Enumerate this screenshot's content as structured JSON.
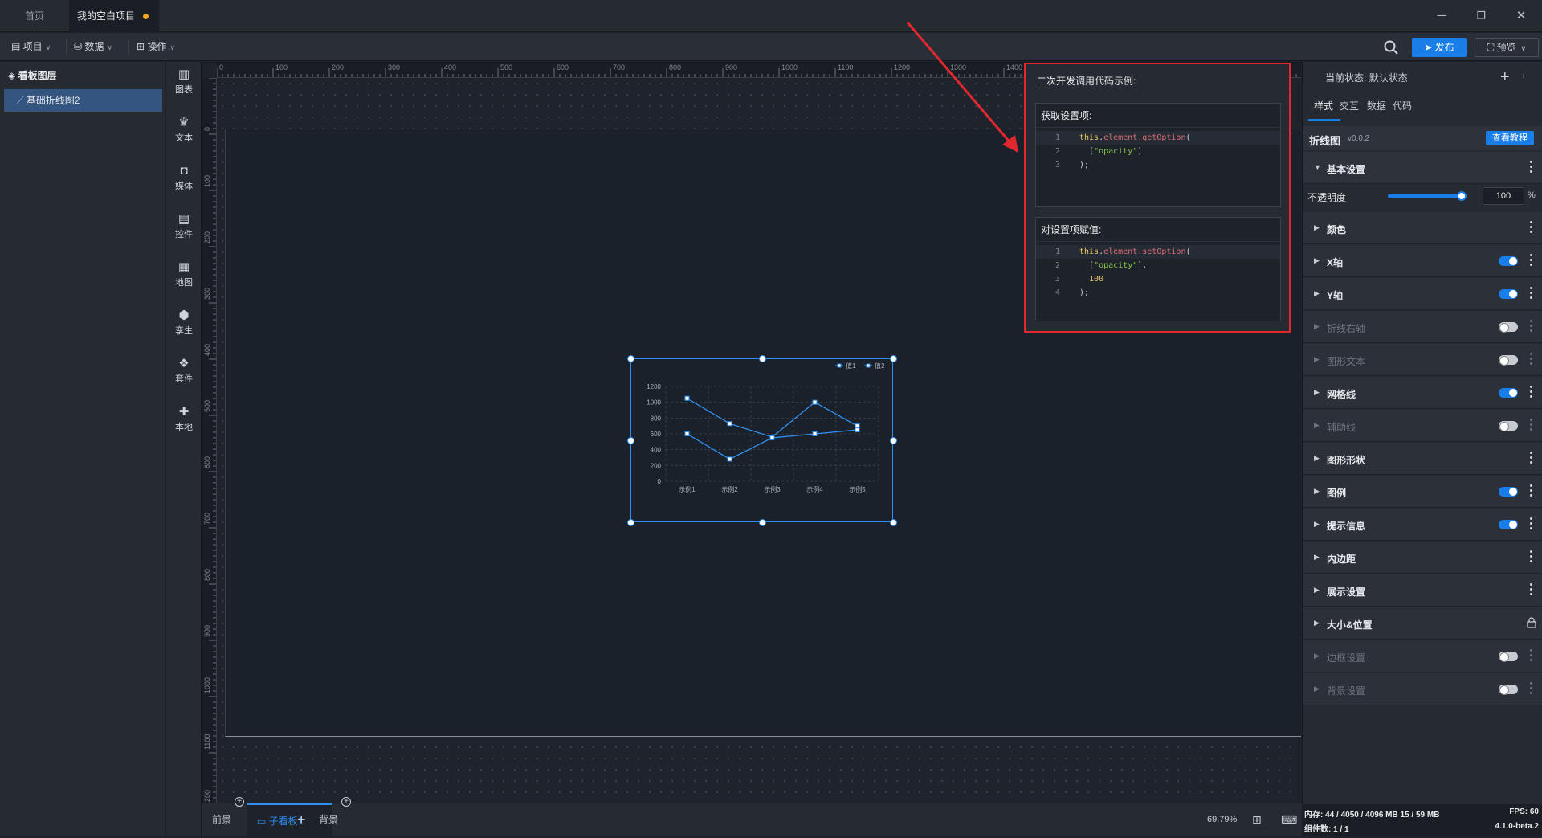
{
  "titlebar": {
    "tabs": [
      {
        "label": "首页"
      },
      {
        "label": "我的空白项目"
      }
    ]
  },
  "menubar": {
    "menus": [
      {
        "label": "项目"
      },
      {
        "label": "数据"
      },
      {
        "label": "操作"
      }
    ],
    "publish": "发布",
    "preview": "预览"
  },
  "layers": {
    "title": "看板图层",
    "items": [
      {
        "label": "基础折线图2"
      }
    ]
  },
  "toolbox": [
    {
      "label": "图表",
      "icon": "bar-chart-icon"
    },
    {
      "label": "文本",
      "icon": "text-icon"
    },
    {
      "label": "媒体",
      "icon": "media-icon"
    },
    {
      "label": "控件",
      "icon": "widget-icon"
    },
    {
      "label": "地图",
      "icon": "map-icon"
    },
    {
      "label": "孪生",
      "icon": "twin-cube-icon"
    },
    {
      "label": "套件",
      "icon": "suite-icon"
    },
    {
      "label": "本地",
      "icon": "puzzle-icon"
    }
  ],
  "ruler": {
    "top": [
      "0",
      "100",
      "200",
      "300",
      "400",
      "500",
      "600",
      "700",
      "800",
      "900",
      "1000",
      "1100",
      "1200",
      "1300",
      "1400"
    ],
    "left": [
      "0",
      "100",
      "200",
      "300",
      "400",
      "500",
      "600",
      "700",
      "800",
      "900",
      "1000",
      "1100",
      "1200"
    ]
  },
  "code_popup": {
    "title": "二次开发调用代码示例:",
    "get_title": "获取设置项:",
    "get_lines": [
      {
        "n": "1",
        "parts": [
          [
            "kw",
            "this"
          ],
          [
            "pl",
            "."
          ],
          [
            "fn",
            "element.getOption"
          ],
          [
            "pl",
            "("
          ]
        ]
      },
      {
        "n": "2",
        "parts": [
          [
            "pl",
            "  ["
          ],
          [
            "str",
            "\"opacity\""
          ],
          [
            "pl",
            "]"
          ]
        ]
      },
      {
        "n": "3",
        "parts": [
          [
            "pl",
            ");"
          ]
        ]
      }
    ],
    "set_title": "对设置项赋值:",
    "set_lines": [
      {
        "n": "1",
        "parts": [
          [
            "kw",
            "this"
          ],
          [
            "pl",
            "."
          ],
          [
            "fn",
            "element.setOption"
          ],
          [
            "pl",
            "("
          ]
        ]
      },
      {
        "n": "2",
        "parts": [
          [
            "pl",
            "  ["
          ],
          [
            "str",
            "\"opacity\""
          ],
          [
            "pl",
            "],"
          ]
        ]
      },
      {
        "n": "3",
        "parts": [
          [
            "num",
            "  100"
          ]
        ]
      },
      {
        "n": "4",
        "parts": [
          [
            "pl",
            ");"
          ]
        ]
      }
    ]
  },
  "chart_data": {
    "type": "line",
    "categories": [
      "示例1",
      "示例2",
      "示例3",
      "示例4",
      "示例5"
    ],
    "series": [
      {
        "name": "值1",
        "values": [
          1050,
          730,
          560,
          1000,
          700
        ]
      },
      {
        "name": "值2",
        "values": [
          600,
          280,
          550,
          600,
          650
        ]
      }
    ],
    "ylim": [
      0,
      1200
    ],
    "yticks": [
      "0",
      "200",
      "400",
      "600",
      "800",
      "1000",
      "1200"
    ],
    "grid": true,
    "legend_position": "top-right",
    "color": "#2f8ff0"
  },
  "props": {
    "state_label": "当前状态:",
    "state_value": "默认状态",
    "tabs": [
      {
        "label": "样式"
      },
      {
        "label": "交互"
      },
      {
        "label": "数据"
      },
      {
        "label": "代码"
      }
    ],
    "component_name": "折线图",
    "component_version": "v0.0.2",
    "tutorial_button": "查看教程",
    "basic_section": "基本设置",
    "opacity_label": "不透明度",
    "opacity_value": "100",
    "opacity_unit": "%",
    "opacity_level": 1.0,
    "sections": [
      {
        "label": "颜色",
        "toggle": null,
        "enabled": true
      },
      {
        "label": "X轴",
        "toggle": true,
        "enabled": true
      },
      {
        "label": "Y轴",
        "toggle": true,
        "enabled": true
      },
      {
        "label": "折线右轴",
        "toggle": false,
        "enabled": false
      },
      {
        "label": "图形文本",
        "toggle": false,
        "enabled": false
      },
      {
        "label": "网格线",
        "toggle": true,
        "enabled": true
      },
      {
        "label": "辅助线",
        "toggle": false,
        "enabled": false
      },
      {
        "label": "图形形状",
        "toggle": null,
        "enabled": true
      },
      {
        "label": "图例",
        "toggle": true,
        "enabled": true
      },
      {
        "label": "提示信息",
        "toggle": true,
        "enabled": true
      },
      {
        "label": "内边距",
        "toggle": null,
        "enabled": true
      },
      {
        "label": "展示设置",
        "toggle": null,
        "enabled": true
      },
      {
        "label": "大小&位置",
        "toggle": null,
        "enabled": true,
        "lock": true
      },
      {
        "label": "边框设置",
        "toggle": false,
        "enabled": false
      },
      {
        "label": "背景设置",
        "toggle": false,
        "enabled": false
      }
    ]
  },
  "bottombar": {
    "foreground": "前景",
    "subboard": "子看板1",
    "background": "背景",
    "zoom": "69.79%"
  },
  "status": {
    "memory": "内存: 44 / 4050 / 4096 MB  15 / 59 MB",
    "fps": "FPS: 60",
    "components": "组件数: 1 / 1",
    "version": "4.1.0-beta.2"
  }
}
